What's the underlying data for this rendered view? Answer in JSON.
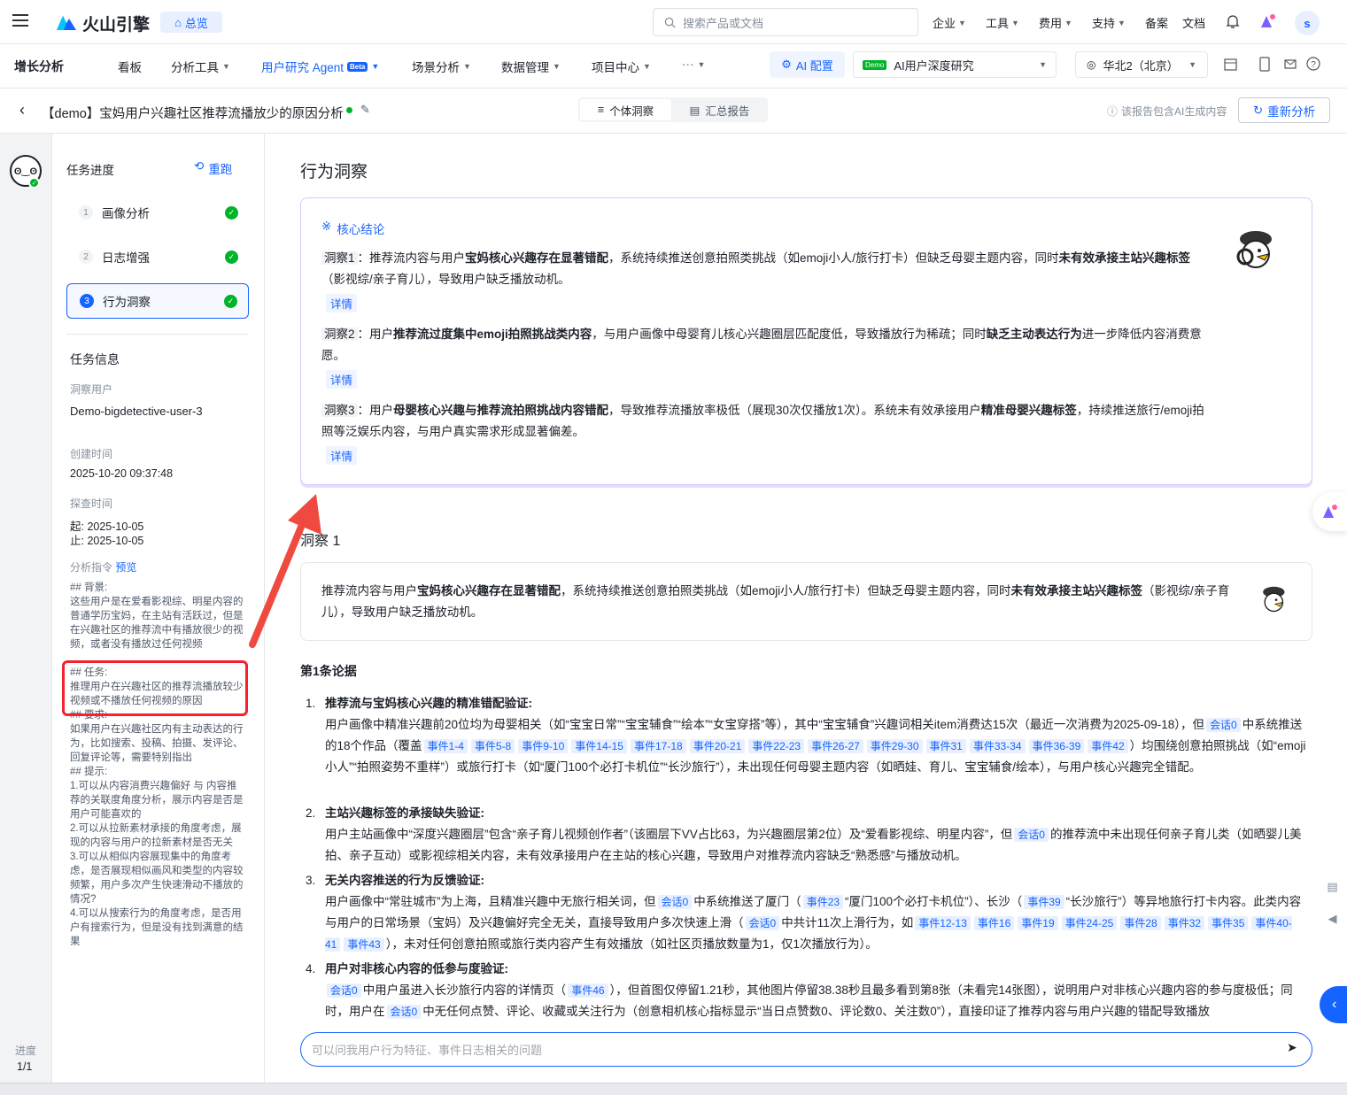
{
  "header": {
    "logo_text": "火山引擎",
    "home_label": "总览",
    "search_placeholder": "搜索产品或文档",
    "nav": [
      "企业",
      "工具",
      "费用",
      "支持"
    ],
    "links": [
      "备案",
      "文档"
    ],
    "avatar_letter": "s"
  },
  "subnav": {
    "product": "增长分析",
    "items": [
      "看板",
      "分析工具",
      "用户研究 Agent",
      "场景分析",
      "数据管理",
      "项目中心",
      "···"
    ],
    "beta_label": "Beta",
    "ai_config": "AI 配置",
    "demo_tag": "Demo",
    "project": "AI用户深度研究",
    "region": "华北2（北京）"
  },
  "titlebar": {
    "title": "【demo】宝妈用户兴趣社区推荐流播放少的原因分析",
    "tab_individual": "个体洞察",
    "tab_summary": "汇总报告",
    "ai_notice": "该报告包含AI生成内容",
    "regen_label": "重新分析"
  },
  "sidebar": {
    "progress_title": "任务进度",
    "rerun_label": "重跑",
    "steps": [
      {
        "num": "1",
        "label": "画像分析"
      },
      {
        "num": "2",
        "label": "日志增强"
      },
      {
        "num": "3",
        "label": "行为洞察"
      }
    ],
    "info_title": "任务信息",
    "user_label": "洞察用户",
    "user_value": "Demo-bigdetective-user-3",
    "created_label": "创建时间",
    "created_value": "2025-10-20 09:37:48",
    "explore_label": "探查时间",
    "explore_start": "起: 2025-10-05",
    "explore_end": "止: 2025-10-05",
    "instr_label": "分析指令",
    "preview_label": "预览",
    "instr_bg": "## 背景:\n这些用户是在爱看影视综、明星内容的普通学历宝妈，在主站有活跃过，但是在兴趣社区的推荐流中有播放很少的视频，或者没有播放过任何视频",
    "instr_task": "## 任务:\n推理用户在兴趣社区的推荐流播放较少视频或不播放任何视频的原因",
    "instr_req": "## 要求:\n如果用户在兴趣社区内有主动表达的行为，比如搜索、投稿、拍摄、发评论、回复评论等，需要特别指出\n## 提示:\n1.可以从内容消费兴趣偏好 与 内容推荐的关联度角度分析，展示内容是否是用户可能喜欢的\n2.可以从拉新素材承接的角度考虑，展现的内容与用户的拉新素材是否无关\n3.可以从相似内容展现集中的角度考虑，是否展现相似画风和类型的内容较频繁，用户多次产生快速滑动不播放的情况?\n4.可以从搜索行为的角度考虑，是否用户有搜索行为，但是没有找到满意的结果"
  },
  "rail": {
    "progress_label": "进度",
    "progress_value": "1/1"
  },
  "main": {
    "section_title": "行为洞察",
    "core_title": "核心结论",
    "detail_label": "详情",
    "insight1_tag": "洞察1",
    "insight1_a": "：推荐流内容与用户",
    "insight1_b": "宝妈核心兴趣存在显著错配",
    "insight1_c": "，系统持续推送创意拍照类挑战（如emoji小人/旅行打卡）但缺乏母婴主题内容，同时",
    "insight1_d": "未有效承接主站兴趣标签",
    "insight1_e": "（影视综/亲子育儿），导致用户缺乏播放动机。",
    "insight2_tag": "洞察2",
    "insight2_a": "：用户",
    "insight2_b": "推荐流过度集中emoji拍照挑战类内容",
    "insight2_c": "，与用户画像中母婴育儿核心兴趣圈层匹配度低，导致播放行为稀疏；同时",
    "insight2_d": "缺乏主动表达行为",
    "insight2_e": "进一步降低内容消费意愿。",
    "insight3_tag": "洞察3",
    "insight3_a": "：用户",
    "insight3_b": "母婴核心兴趣与推荐流拍照挑战内容错配",
    "insight3_c": "，导致推荐流播放率极低（展现30次仅播放1次）。系统未有效承接用户",
    "insight3_d": "精准母婴兴趣标签",
    "insight3_e": "，持续推送旅行/emoji拍照等泛娱乐内容，与用户真实需求形成显著偏差。",
    "insight_section": "洞察 1",
    "summary_a": "推荐流内容与用户",
    "summary_b": "宝妈核心兴趣存在显著错配",
    "summary_c": "，系统持续推送创意拍照类挑战（如emoji小人/旅行打卡）但缺乏母婴主题内容，同时",
    "summary_d": "未有效承接主站兴趣标签",
    "summary_e": "（影视综/亲子育儿），导致用户缺乏播放动机。",
    "evidence_title": "第1条论据",
    "chat_placeholder": "可以问我用户行为特征、事件日志相关的问题"
  },
  "evidence": {
    "e1_num": "1.",
    "e1_title": "推荐流与宝妈核心兴趣的精准错配验证:",
    "e1_t1": "用户画像中精准兴趣前20位均为母婴相关（如“宝宝日常”“宝宝辅食”“绘本”“女宝穿搭”等），其中“宝宝辅食”兴趣词相关item消费达15次（最近一次消费为2025-09-18），但",
    "e1_t2": "中系统推送的18个作品（覆盖",
    "e1_t3": "）均围绕创意拍照挑战（如“emoji小人”“拍照姿势不重样”）或旅行打卡（如“厦门100个必打卡机位”“长沙旅行”），未出现任何母婴主题内容（如晒娃、育儿、宝宝辅食/绘本），与用户核心兴趣完全错配。",
    "e1_events": [
      "事件1-4",
      "事件5-8",
      "事件9-10",
      "事件14-15",
      "事件17-18",
      "事件20-21",
      "事件22-23",
      "事件26-27",
      "事件29-30",
      "事件31",
      "事件33-34",
      "事件36-39",
      "事件42"
    ],
    "e2_num": "2.",
    "e2_title": "主站兴趣标签的承接缺失验证:",
    "e2_t1": "用户主站画像中“深度兴趣圈层”包含“亲子育儿视频创作者”（该圈层下VV占比63，为兴趣圈层第2位）及“爱看影视综、明星内容”，但",
    "e2_t2": "的推荐流中未出现任何亲子育儿类（如晒婴儿美拍、亲子互动）或影视综相关内容，未有效承接用户在主站的核心兴趣，导致用户对推荐流内容缺乏“熟悉感”与播放动机。",
    "e3_num": "3.",
    "e3_title": "无关内容推送的行为反馈验证:",
    "e3_t1": "用户画像中“常驻城市”为上海，且精准兴趣中无旅行相关词，但",
    "e3_t2": "中系统推送了厦门（",
    "e3_t3": "“厦门100个必打卡机位”）、长沙（",
    "e3_t4": "“长沙旅行”）等异地旅行打卡内容。此类内容与用户的日常场景（宝妈）及兴趣偏好完全无关，直接导致用户多次快速上滑（",
    "e3_t5": "中共计11次上滑行为，如",
    "e3_t6": "），未对任何创意拍照或旅行类内容产生有效播放（如社区页播放数量为1，仅1次播放行为）。",
    "e3_ev_a": "事件23",
    "e3_ev_b": "事件39",
    "e3_events": [
      "事件12-13",
      "事件16",
      "事件19",
      "事件24-25",
      "事件28",
      "事件32",
      "事件35",
      "事件40-41",
      "事件43"
    ],
    "e4_num": "4.",
    "e4_title": "用户对非核心内容的低参与度验证:",
    "e4_t1": "中用户虽进入长沙旅行内容的详情页（",
    "e4_t2": "），但首图仅停留1.21秒，其他图片停留38.38秒且最多看到第8张（未看完14张图），说明用户对非核心兴趣内容的参与度极低；同时，用户在",
    "e4_t3": "中无任何点赞、评论、收藏或关注行为（创意相机核心指标显示“当日点赞数0、评论数0、关注数0”），直接印证了推荐内容与用户兴趣的错配导致播放",
    "e4_ev": "事件46",
    "session_label": "会话0"
  }
}
